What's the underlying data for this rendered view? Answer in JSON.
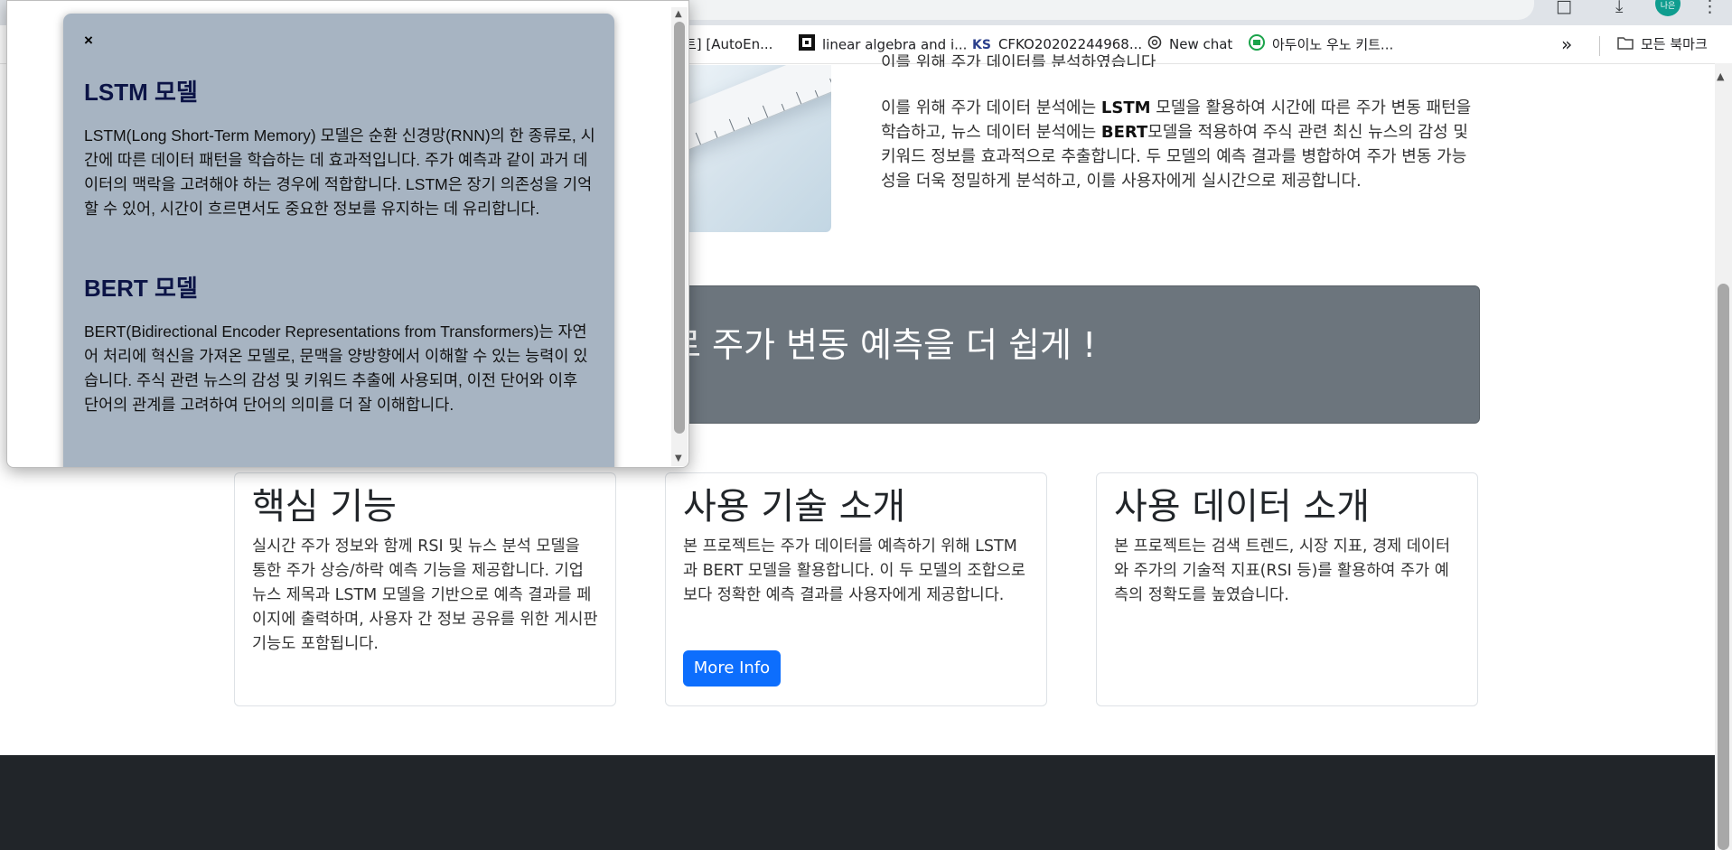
{
  "browser": {
    "bookmarks": [
      {
        "label": "트] [AutoEn...",
        "icon": "page-icon"
      },
      {
        "label": "linear algebra and i...",
        "icon": "bookmark-favicon"
      },
      {
        "label": "CFKO20202244968...",
        "icon": "ks-favicon"
      },
      {
        "label": "New chat",
        "icon": "chatgpt-icon"
      },
      {
        "label": "아두이노 우노 키트...",
        "icon": "bookmark-favicon"
      }
    ],
    "ks_badge": "KS",
    "more_bookmarks": "»",
    "all_bookmarks": "모든 북마크",
    "avatar_text": "나은"
  },
  "hero": {
    "cut_line": "이를 위해 주가 데이터를 분석하였습니다",
    "intro_parts": [
      "이를 위해 주가 데이터 분석에는 ",
      "LSTM",
      " 모델을 활용하여 시간에 따른 주가 변동 패턴을 학습하고, 뉴스 데이터 분석에는 ",
      "BERT",
      "모델을 적용하여 주식 관련 최신 뉴스의 감성 및 키워드 정보를 효과적으로 추출합니다. 두 모델의 예측 결과를 병합하여 주가 변동 가능성을 더욱 정밀하게 분석하고, 이를 사용자에게 실시간으로 제공합니다."
    ]
  },
  "jumbotron": {
    "text": "로 주가 변동 예측을 더 쉽게 !"
  },
  "cards": [
    {
      "title": "핵심 기능",
      "body": "실시간 주가 정보와 함께 RSI 및 뉴스 분석 모델을 통한 주가 상승/하락 예측 기능을 제공합니다. 기업 뉴스 제목과 LSTM 모델을 기반으로 예측 결과를 페이지에 출력하며, 사용자 간 정보 공유를 위한 게시판 기능도 포함됩니다."
    },
    {
      "title": "사용 기술 소개",
      "body": "본 프로젝트는 주가 데이터를 예측하기 위해 LSTM과 BERT 모델을 활용합니다. 이 두 모델의 조합으로 보다 정확한 예측 결과를 사용자에게 제공합니다.",
      "button": "More Info"
    },
    {
      "title": "사용 데이터 소개",
      "body": "본 프로젝트는 검색 트렌드, 시장 지표, 경제 데이터와 주가의 기술적 지표(RSI 등)를 활용하여 주가 예측의 정확도를 높였습니다."
    }
  ],
  "modal": {
    "close": "×",
    "sections": [
      {
        "heading": "LSTM 모델",
        "body": "LSTM(Long Short-Term Memory) 모델은 순환 신경망(RNN)의 한 종류로, 시간에 따른 데이터 패턴을 학습하는 데 효과적입니다. 주가 예측과 같이 과거 데이터의 맥락을 고려해야 하는 경우에 적합합니다. LSTM은 장기 의존성을 기억할 수 있어, 시간이 흐르면서도 중요한 정보를 유지하는 데 유리합니다."
      },
      {
        "heading": "BERT 모델",
        "body": "BERT(Bidirectional Encoder Representations from Transformers)는 자연어 처리에 혁신을 가져온 모델로, 문맥을 양방향에서 이해할 수 있는 능력이 있습니다. 주식 관련 뉴스의 감성 및 키워드 추출에 사용되며, 이전 단어와 이후 단어의 관계를 고려하여 단어의 의미를 더 잘 이해합니다."
      }
    ]
  },
  "colors": {
    "modal_bg": "#a7b4c2",
    "jumbotron_bg": "#6c757d",
    "button_bg": "#0d6efd",
    "footer_bg": "#212529",
    "heading_navy": "#0c1446"
  }
}
